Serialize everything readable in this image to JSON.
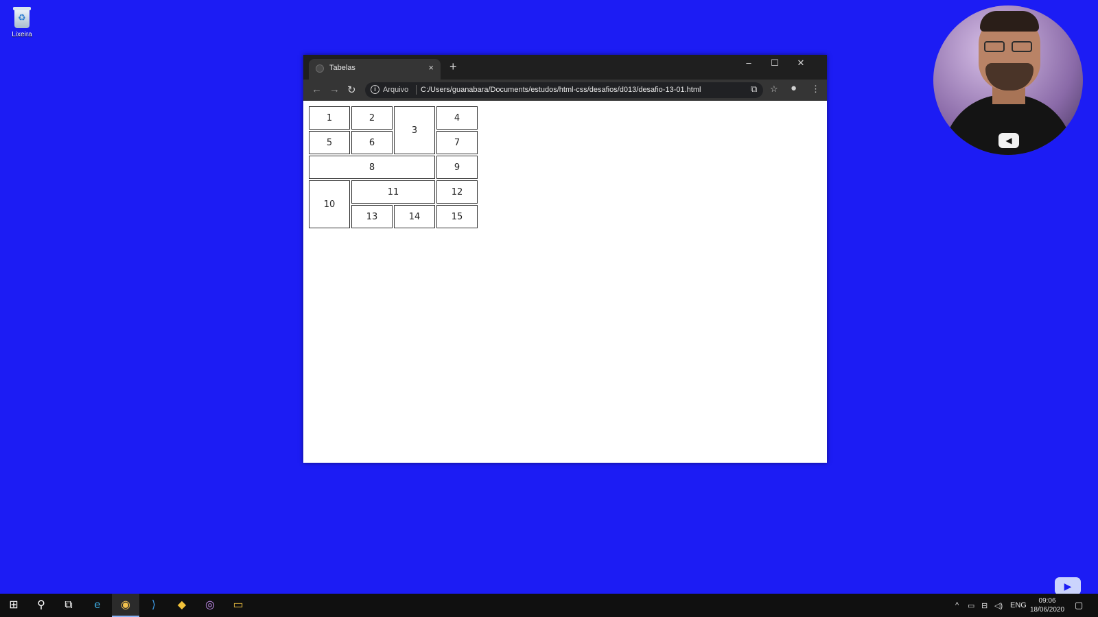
{
  "desktop": {
    "recycle_bin_label": "Lixeira"
  },
  "browser": {
    "tab_title": "Tabelas",
    "tab_close": "×",
    "new_tab": "+",
    "window_controls": {
      "minimize": "–",
      "maximize": "☐",
      "close": "✕"
    },
    "nav": {
      "back": "←",
      "forward": "→",
      "reload": "↻"
    },
    "address": {
      "info": "i",
      "scheme_label": "Arquivo",
      "url": "C:/Users/guanabara/Documents/estudos/html-css/desafios/d013/desafio-13-01.html"
    },
    "toolbar_right": {
      "translate": "⧉",
      "bookmark": "☆",
      "profile": "●",
      "menu": "⋮"
    }
  },
  "table": {
    "cells": [
      "1",
      "2",
      "3",
      "4",
      "5",
      "6",
      "7",
      "8",
      "9",
      "10",
      "11",
      "12",
      "13",
      "14",
      "15"
    ]
  },
  "webcam": {
    "badge": "◀"
  },
  "youtube_icon": "▶",
  "taskbar": {
    "start": "⊞",
    "search": "⚲",
    "task_view": "⧉",
    "apps": [
      "e",
      "◉",
      "⟩",
      "◆",
      "◎",
      "▭"
    ],
    "tray": {
      "chevron": "^",
      "icons": [
        "▭",
        "⊟",
        "◁)"
      ],
      "language": "ENG"
    },
    "clock": {
      "time": "09:06",
      "date": "18/06/2020"
    },
    "notifications": "▢"
  }
}
